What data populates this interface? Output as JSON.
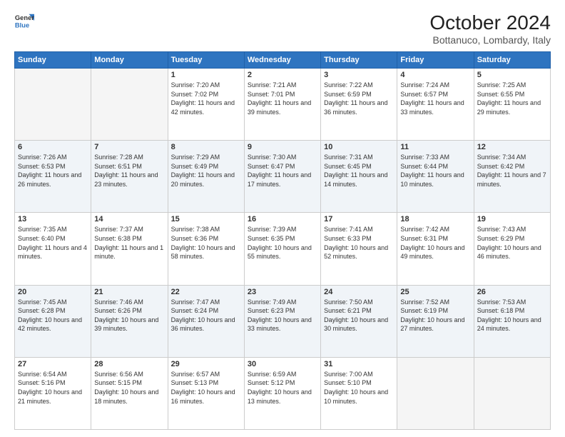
{
  "header": {
    "logo_general": "General",
    "logo_blue": "Blue",
    "month_title": "October 2024",
    "location": "Bottanuco, Lombardy, Italy"
  },
  "weekdays": [
    "Sunday",
    "Monday",
    "Tuesday",
    "Wednesday",
    "Thursday",
    "Friday",
    "Saturday"
  ],
  "weeks": [
    [
      {
        "day": "",
        "info": ""
      },
      {
        "day": "",
        "info": ""
      },
      {
        "day": "1",
        "info": "Sunrise: 7:20 AM\nSunset: 7:02 PM\nDaylight: 11 hours and 42 minutes."
      },
      {
        "day": "2",
        "info": "Sunrise: 7:21 AM\nSunset: 7:01 PM\nDaylight: 11 hours and 39 minutes."
      },
      {
        "day": "3",
        "info": "Sunrise: 7:22 AM\nSunset: 6:59 PM\nDaylight: 11 hours and 36 minutes."
      },
      {
        "day": "4",
        "info": "Sunrise: 7:24 AM\nSunset: 6:57 PM\nDaylight: 11 hours and 33 minutes."
      },
      {
        "day": "5",
        "info": "Sunrise: 7:25 AM\nSunset: 6:55 PM\nDaylight: 11 hours and 29 minutes."
      }
    ],
    [
      {
        "day": "6",
        "info": "Sunrise: 7:26 AM\nSunset: 6:53 PM\nDaylight: 11 hours and 26 minutes."
      },
      {
        "day": "7",
        "info": "Sunrise: 7:28 AM\nSunset: 6:51 PM\nDaylight: 11 hours and 23 minutes."
      },
      {
        "day": "8",
        "info": "Sunrise: 7:29 AM\nSunset: 6:49 PM\nDaylight: 11 hours and 20 minutes."
      },
      {
        "day": "9",
        "info": "Sunrise: 7:30 AM\nSunset: 6:47 PM\nDaylight: 11 hours and 17 minutes."
      },
      {
        "day": "10",
        "info": "Sunrise: 7:31 AM\nSunset: 6:45 PM\nDaylight: 11 hours and 14 minutes."
      },
      {
        "day": "11",
        "info": "Sunrise: 7:33 AM\nSunset: 6:44 PM\nDaylight: 11 hours and 10 minutes."
      },
      {
        "day": "12",
        "info": "Sunrise: 7:34 AM\nSunset: 6:42 PM\nDaylight: 11 hours and 7 minutes."
      }
    ],
    [
      {
        "day": "13",
        "info": "Sunrise: 7:35 AM\nSunset: 6:40 PM\nDaylight: 11 hours and 4 minutes."
      },
      {
        "day": "14",
        "info": "Sunrise: 7:37 AM\nSunset: 6:38 PM\nDaylight: 11 hours and 1 minute."
      },
      {
        "day": "15",
        "info": "Sunrise: 7:38 AM\nSunset: 6:36 PM\nDaylight: 10 hours and 58 minutes."
      },
      {
        "day": "16",
        "info": "Sunrise: 7:39 AM\nSunset: 6:35 PM\nDaylight: 10 hours and 55 minutes."
      },
      {
        "day": "17",
        "info": "Sunrise: 7:41 AM\nSunset: 6:33 PM\nDaylight: 10 hours and 52 minutes."
      },
      {
        "day": "18",
        "info": "Sunrise: 7:42 AM\nSunset: 6:31 PM\nDaylight: 10 hours and 49 minutes."
      },
      {
        "day": "19",
        "info": "Sunrise: 7:43 AM\nSunset: 6:29 PM\nDaylight: 10 hours and 46 minutes."
      }
    ],
    [
      {
        "day": "20",
        "info": "Sunrise: 7:45 AM\nSunset: 6:28 PM\nDaylight: 10 hours and 42 minutes."
      },
      {
        "day": "21",
        "info": "Sunrise: 7:46 AM\nSunset: 6:26 PM\nDaylight: 10 hours and 39 minutes."
      },
      {
        "day": "22",
        "info": "Sunrise: 7:47 AM\nSunset: 6:24 PM\nDaylight: 10 hours and 36 minutes."
      },
      {
        "day": "23",
        "info": "Sunrise: 7:49 AM\nSunset: 6:23 PM\nDaylight: 10 hours and 33 minutes."
      },
      {
        "day": "24",
        "info": "Sunrise: 7:50 AM\nSunset: 6:21 PM\nDaylight: 10 hours and 30 minutes."
      },
      {
        "day": "25",
        "info": "Sunrise: 7:52 AM\nSunset: 6:19 PM\nDaylight: 10 hours and 27 minutes."
      },
      {
        "day": "26",
        "info": "Sunrise: 7:53 AM\nSunset: 6:18 PM\nDaylight: 10 hours and 24 minutes."
      }
    ],
    [
      {
        "day": "27",
        "info": "Sunrise: 6:54 AM\nSunset: 5:16 PM\nDaylight: 10 hours and 21 minutes."
      },
      {
        "day": "28",
        "info": "Sunrise: 6:56 AM\nSunset: 5:15 PM\nDaylight: 10 hours and 18 minutes."
      },
      {
        "day": "29",
        "info": "Sunrise: 6:57 AM\nSunset: 5:13 PM\nDaylight: 10 hours and 16 minutes."
      },
      {
        "day": "30",
        "info": "Sunrise: 6:59 AM\nSunset: 5:12 PM\nDaylight: 10 hours and 13 minutes."
      },
      {
        "day": "31",
        "info": "Sunrise: 7:00 AM\nSunset: 5:10 PM\nDaylight: 10 hours and 10 minutes."
      },
      {
        "day": "",
        "info": ""
      },
      {
        "day": "",
        "info": ""
      }
    ]
  ]
}
